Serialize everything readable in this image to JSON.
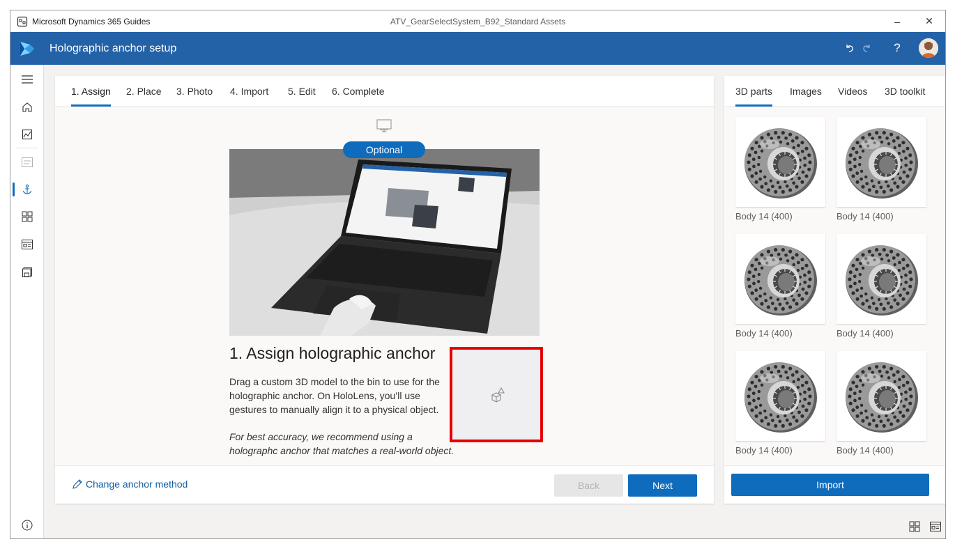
{
  "window": {
    "app_name": "Microsoft Dynamics 365 Guides",
    "document_name": "ATV_GearSelectSystem_B92_Standard Assets",
    "minimize": "–",
    "close": "✕"
  },
  "header": {
    "title": "Holographic anchor setup",
    "help": "?"
  },
  "tabs": [
    "1. Assign",
    "2. Place",
    "3. Photo",
    "4. Import",
    "5. Edit",
    "6. Complete"
  ],
  "optional_badge": "Optional",
  "step": {
    "heading": "1. Assign holographic anchor",
    "body": "Drag a custom 3D model to the bin to use for the holographic anchor. On HoloLens, you’ll use gestures to manually align it to a physical object.",
    "note": "For best accuracy, we recommend using a holographc anchor that matches a real-world object."
  },
  "footer": {
    "change_anchor": "Change anchor method",
    "back": "Back",
    "next": "Next"
  },
  "side": {
    "tabs": [
      "3D parts",
      "Images",
      "Videos",
      "3D toolkit"
    ],
    "assets": [
      {
        "label": "Body 14 (400)"
      },
      {
        "label": "Body 14 (400)"
      },
      {
        "label": "Body 14 (400)"
      },
      {
        "label": "Body 14 (400)"
      },
      {
        "label": "Body 14 (400)"
      },
      {
        "label": "Body 14 (400)"
      }
    ],
    "import": "Import"
  },
  "colors": {
    "header": "#2462a8",
    "accent": "#0f6cbd",
    "highlight": "#e50000"
  }
}
